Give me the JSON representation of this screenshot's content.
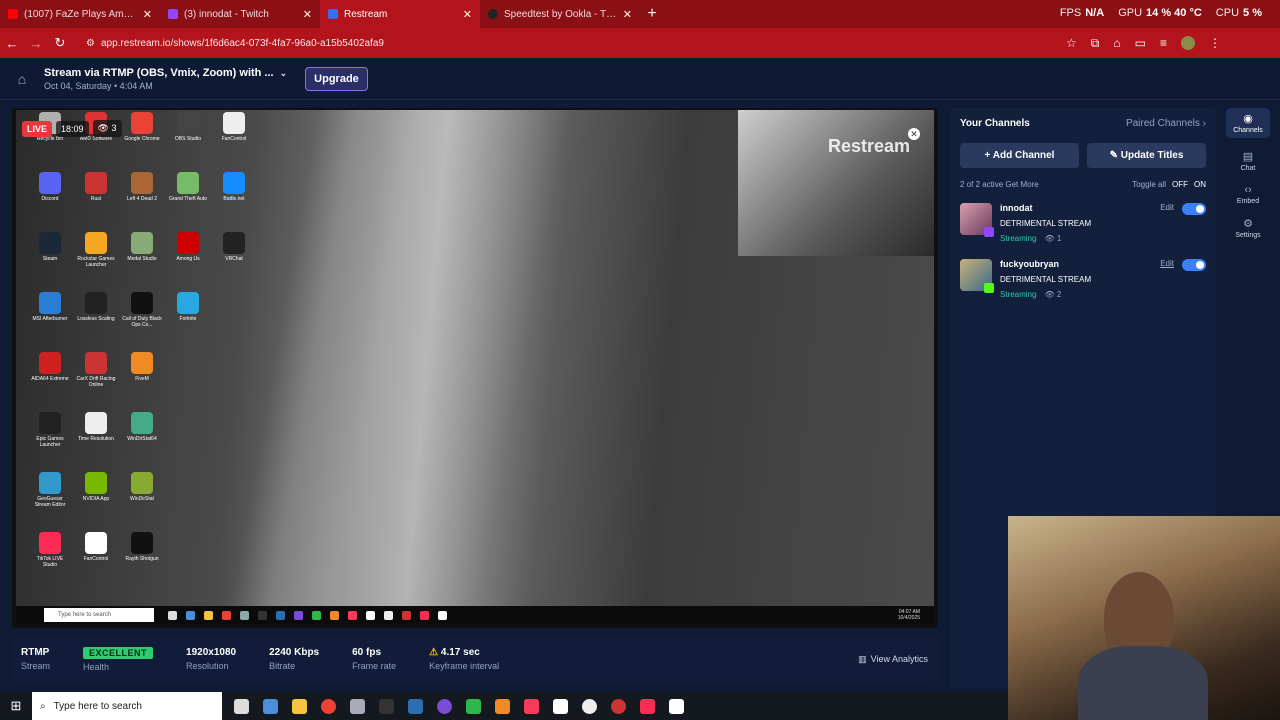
{
  "browser": {
    "tabs": [
      {
        "label": "(1007) FaZe Plays Among Us",
        "color": "#ff0000"
      },
      {
        "label": "(3) innodat - Twitch",
        "color": "#9146ff"
      },
      {
        "label": "Restream",
        "color": "#3b6df2"
      },
      {
        "label": "Speedtest by Ookla - The Glob",
        "color": "#222222"
      }
    ],
    "new_tab": "+",
    "url": "app.restream.io/shows/1f6d6ac4-073f-4fa7-96a0-a15b5402afa9"
  },
  "overlay_stats": {
    "fps_label": "FPS",
    "fps_value": "N/A",
    "gpu_label": "GPU",
    "gpu_value": "14 % 40 °C",
    "cpu_label": "CPU",
    "cpu_value": "5 %"
  },
  "header": {
    "title": "Stream via RTMP (OBS, Vmix, Zoom) with ...",
    "subtitle": "Oct 04, Saturday • 4:04 AM",
    "upgrade": "Upgrade"
  },
  "preview": {
    "live": "LIVE",
    "timer": "18:09",
    "viewers": "3",
    "watermark": "Restream",
    "vm_search": "Type here to search",
    "vm_time": "04:07 AM",
    "vm_date": "10/4/2025",
    "desktop_icons": [
      "Recycle Bin",
      "AMD Software",
      "Google Chrome",
      "OBS Studio",
      "FanControl",
      "Discord",
      "Rust",
      "Left 4 Dead 2",
      "Grand Theft Auto",
      "Battle.net",
      "Steam",
      "Rockstar Games Launcher",
      "Medal Studio",
      "Among Us",
      "VRChat",
      "MSI Afterburner",
      "Lossless Scaling",
      "Call of Duty Black Ops Co...",
      "Fortnite",
      "",
      "AIDA64 Extreme",
      "CarX Drift Racing Online",
      "FiveM",
      "",
      "",
      "Epic Games Launcher",
      "Time Resolution",
      "WinDirStat64",
      "",
      "",
      "GeoGuessr Stream Editor",
      "NVIDIA App",
      "WinDirStat",
      "",
      "",
      "TikTok LIVE Studio",
      "FanControl",
      "Rayth Shotgun",
      "",
      ""
    ]
  },
  "stats": {
    "protocol": "RTMP",
    "protocol_label": "Stream",
    "health": "EXCELLENT",
    "health_label": "Health",
    "resolution": "1920x1080",
    "resolution_label": "Resolution",
    "bitrate": "2240 Kbps",
    "bitrate_label": "Bitrate",
    "framerate": "60 fps",
    "framerate_label": "Frame rate",
    "keyframe": "4.17 sec",
    "keyframe_label": "Keyframe interval",
    "analytics": "View Analytics"
  },
  "channels": {
    "heading": "Your Channels",
    "paired": "Paired Channels",
    "add_channel": "Add Channel",
    "update_titles": "Update Titles",
    "active": "2 of 2 active",
    "get_more": "Get More",
    "toggle_all": "Toggle all",
    "off": "OFF",
    "on": "ON",
    "items": [
      {
        "name": "innodat",
        "title": "DETRIMENTAL STREAM",
        "status": "Streaming",
        "viewers": "1",
        "edit": "Edit",
        "badge_color": "#9146ff"
      },
      {
        "name": "fuckyoubryan",
        "title": "DETRIMENTAL STREAM",
        "status": "Streaming",
        "viewers": "2",
        "edit": "Edit",
        "badge_color": "#53fc18"
      }
    ]
  },
  "sidebar": {
    "items": [
      {
        "label": "Channels",
        "icon": "broadcast-icon"
      },
      {
        "label": "Chat",
        "icon": "chat-icon"
      },
      {
        "label": "Embed",
        "icon": "code-icon"
      },
      {
        "label": "Settings",
        "icon": "gear-icon"
      }
    ]
  },
  "taskbar": {
    "search": "Type here to search"
  }
}
